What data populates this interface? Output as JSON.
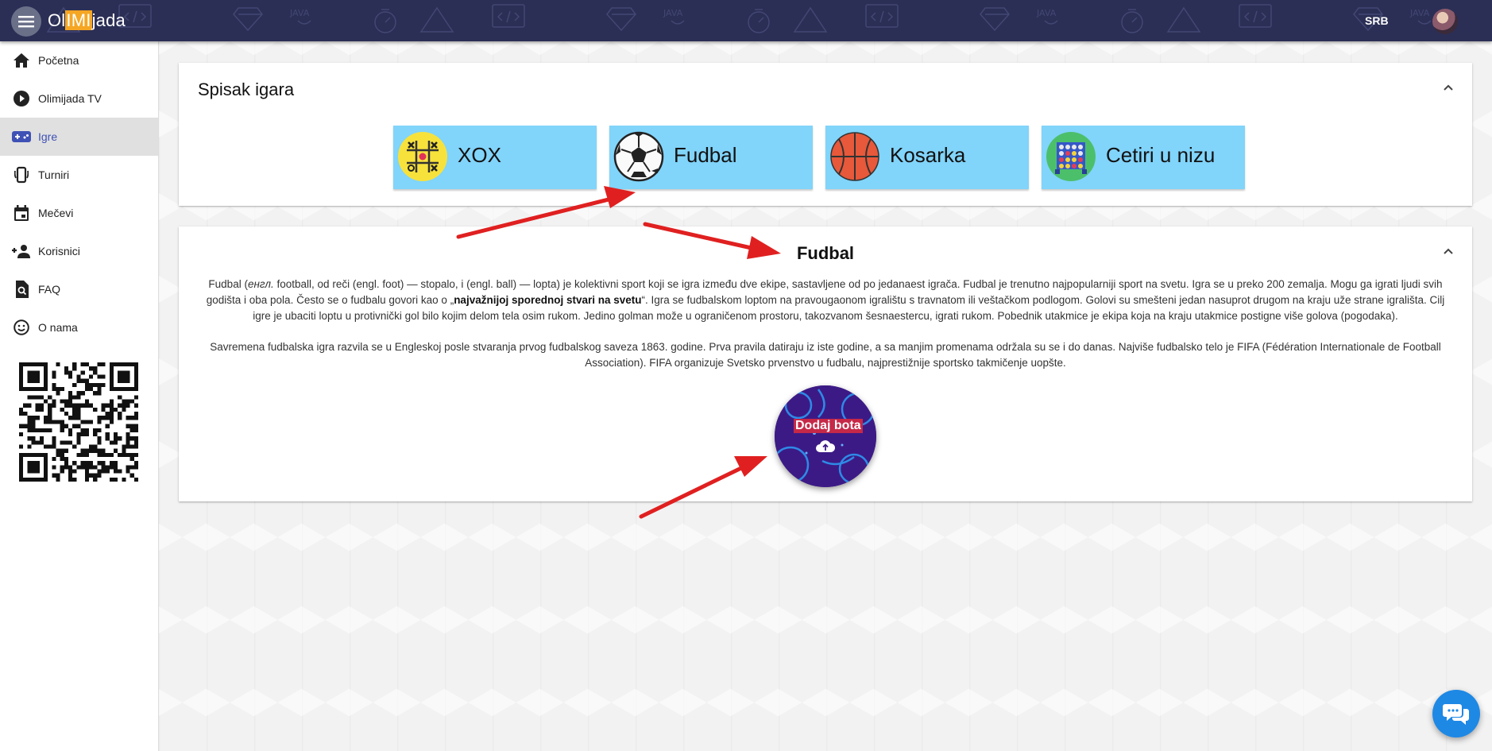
{
  "header": {
    "logo_prefix": "Ol",
    "logo_highlight": "IMI",
    "logo_suffix": "jada",
    "language": "SRB"
  },
  "sidebar": {
    "items": [
      {
        "label": "Početna",
        "icon": "home-icon"
      },
      {
        "label": "Olimijada TV",
        "icon": "play-circle-icon"
      },
      {
        "label": "Igre",
        "icon": "gamepad-icon",
        "active": true
      },
      {
        "label": "Turniri",
        "icon": "phone-rotate-icon"
      },
      {
        "label": "Mečevi",
        "icon": "calendar-icon"
      },
      {
        "label": "Korisnici",
        "icon": "add-user-icon"
      },
      {
        "label": "FAQ",
        "icon": "find-page-icon"
      },
      {
        "label": "O nama",
        "icon": "smiley-icon"
      }
    ]
  },
  "games_card": {
    "title": "Spisak igara",
    "games": [
      {
        "label": "XOX",
        "icon": "tic-tac-toe-icon"
      },
      {
        "label": "Fudbal",
        "icon": "soccer-ball-icon"
      },
      {
        "label": "Kosarka",
        "icon": "basketball-icon"
      },
      {
        "label": "Cetiri u nizu",
        "icon": "connect-four-icon"
      }
    ]
  },
  "detail_card": {
    "title": "Fudbal",
    "paragraph1_part1": "Fudbal (",
    "paragraph1_italic": "енгл.",
    "paragraph1_part2": " football, od reči (engl. foot) — stopalo, i (engl. ball) — lopta) je kolektivni sport koji se igra između dve ekipe, sastavljene od po jedanaest igrača. Fudbal je trenutno najpopularniji sport na svetu. Igra se u preko 200 zemalja. Mogu ga igrati ljudi svih godišta i oba pola. Često se o fudbalu govori kao o „",
    "paragraph1_bold": "najvažnijoj sporednoj stvari na svetu",
    "paragraph1_part3": "“. Igra se fudbalskom loptom na pravougaonom igralištu s travnatom ili veštačkom podlogom. Golovi su smešteni jedan nasuprot drugom na kraju uže strane igrališta. Cilj igre je ubaciti loptu u protivnički gol bilo kojim delom tela osim rukom. Jedino golman može u ograničenom prostoru, takozvanom šesnaestercu, igrati rukom. Pobednik utakmice je ekipa koja na kraju utakmice postigne više golova (pogodaka).",
    "paragraph2": "Savremena fudbalska igra razvila se u Engleskoj posle stvaranja prvog fudbalskog saveza 1863. godine. Prva pravila datiraju iz iste godine, a sa manjim promenama održala su se i do danas. Najviše fudbalsko telo je FIFA (Fédération Internationale de Football Association). FIFA organizuje Svetsko prvenstvo u fudbalu, najprestižnije sportsko takmičenje uopšte.",
    "bot_button_label": "Dodaj bota"
  },
  "colors": {
    "topbar": "#2b2f55",
    "accent": "#3f51b5",
    "game_button": "#81d4fa",
    "bot_label": "#c62848",
    "chat_fab": "#1e88e5",
    "arrow": "#e02020"
  }
}
